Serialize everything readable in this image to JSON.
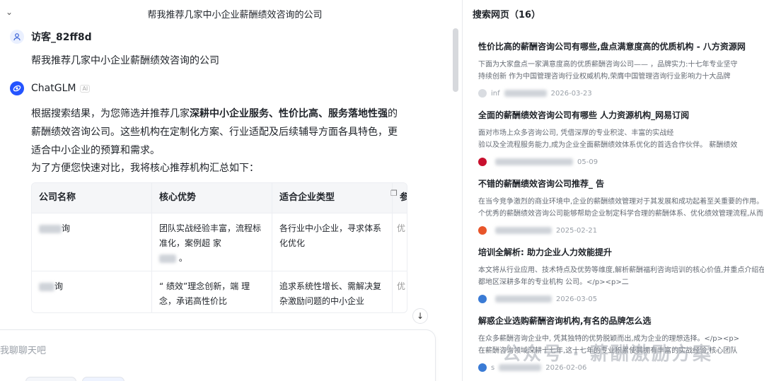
{
  "conversation": {
    "title": "帮我推荐几家中小企业薪酬绩效咨询的公司"
  },
  "user": {
    "name": "访客_82ff8d",
    "message": "帮我推荐几家中小企业薪酬绩效咨询的公司"
  },
  "assistant": {
    "name": "ChatGLM",
    "tag": "AI",
    "intro_prefix": "根据搜索结果，为您筛选并推荐几家",
    "intro_bold": "深耕中小企业服务、性价比高、服务落地性强",
    "intro_suffix": "的薪酬绩效咨询公司。这些机构在定制化方案、行业适配及后续辅导方面各具特色，更适合中小企业的预算和需求。",
    "summary_lead": "为了方便您快速对比，我将核心推荐机构汇总如下："
  },
  "table": {
    "headers": [
      "公司名称",
      "核心优势",
      "适合企业类型",
      "参"
    ],
    "rows": [
      {
        "name": "询",
        "advantage": "团队实战经验丰富，流程标准化，案例超  家",
        "advantage_end": "。",
        "fit": "各行业中小企业，寻求体系化优化",
        "extra": "优"
      },
      {
        "name": "询",
        "advantage": "“  绩效”理念创新，端  理念，承诺高性价比",
        "advantage_end": "",
        "fit": "追求系统性增长、需解决复杂激励问题的中小企业",
        "extra": "优"
      }
    ]
  },
  "input": {
    "placeholder": "我聊聊天吧"
  },
  "search": {
    "header": "搜索网页（16）",
    "results": [
      {
        "title": "性价比高的薪酬咨询公司有哪些,盘点满意度高的优质机构 - 八方资源网",
        "snippet1": "下面为大家盘点一家满意度高的优质薪酬咨询公司——  ，品牌实力:十七年专业坚守",
        "snippet2": "持续创新  作为中国管理咨询行业权威机构,荣膺中国管理咨询行业影响力十大品牌",
        "source": "inf",
        "date": "2026-03-23",
        "favicon_color": "#d9dce1"
      },
      {
        "title": "全面的薪酬绩效咨询公司有哪些  人力资源机构_网易订阅",
        "snippet1": "面对市场上众多咨询公司,  凭借深厚的专业积淀、丰富的实战经",
        "snippet2": "验以及全流程服务能力,成为企业全面薪酬绩效体系优化的首选合作伙伴。  薪酬绩效",
        "source": "",
        "date": "05-09",
        "favicon_color": "#c8102e"
      },
      {
        "title": "不错的薪酬绩效咨询公司推荐_  告",
        "snippet1": "在当今竞争激烈的商业环境中,企业的薪酬绩效管理对于其发展和成功起着至关重要的作用。",
        "snippet2": "个优秀的薪酬绩效咨询公司能够帮助企业制定科学合理的薪酬体系、优化绩效管理流程,从而",
        "source": "",
        "date": "2025-02-21",
        "favicon_color": "#e8552a"
      },
      {
        "title": "培训全解析:  助力企业人力效能提升",
        "snippet1": "本文将从行业应用、技术特点及优势等维度,解析薪酬福利咨询培训的核心价值,并重点介绍在",
        "snippet2": "都地区深耕多年的专业机构  公司。</p><p>二",
        "source": "",
        "date": "2026-03-05",
        "favicon_color": "#3a7bd5"
      },
      {
        "title": "解惑企业选购薪酬咨询机构,有名的品牌怎么选",
        "snippet1": "在众多薪酬咨询企业中,  凭其独特的优势脱颖而出,成为企业的理想选择。</p><p>",
        "snippet2": "在薪酬咨询领域深耕十七年,这十七年的专业积累使其拥有丰富的实战经验,核心团队",
        "source": "s",
        "date": "2026-02-06",
        "favicon_color": "#3a7bd5"
      }
    ]
  },
  "watermark": "公众号 · 薪酬激励方案",
  "colors": {
    "accent": "#2454ff",
    "border": "#eceef2",
    "muted": "#9aa0a8"
  }
}
